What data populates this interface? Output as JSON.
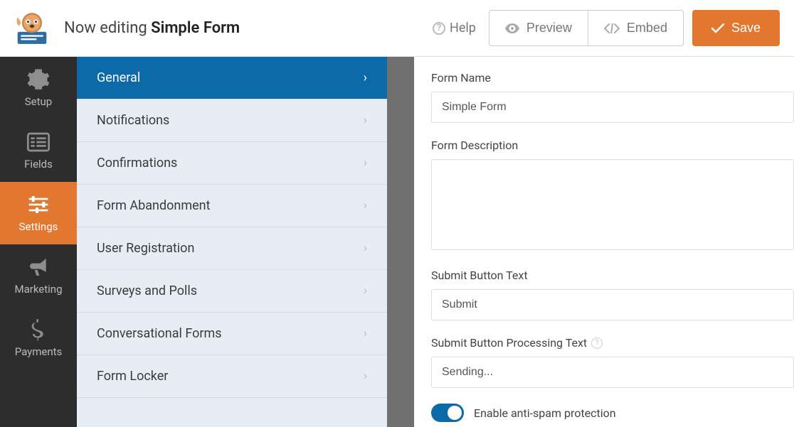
{
  "header": {
    "editing_prefix": "Now editing ",
    "form_name": "Simple Form",
    "help_label": "Help",
    "preview_label": "Preview",
    "embed_label": "Embed",
    "save_label": "Save"
  },
  "vnav": {
    "items": [
      {
        "id": "setup",
        "label": "Setup",
        "icon": "gear"
      },
      {
        "id": "fields",
        "label": "Fields",
        "icon": "list"
      },
      {
        "id": "settings",
        "label": "Settings",
        "icon": "sliders",
        "active": true
      },
      {
        "id": "marketing",
        "label": "Marketing",
        "icon": "bullhorn"
      },
      {
        "id": "payments",
        "label": "Payments",
        "icon": "dollar"
      }
    ]
  },
  "settings_list": {
    "items": [
      {
        "label": "General",
        "active": true
      },
      {
        "label": "Notifications"
      },
      {
        "label": "Confirmations"
      },
      {
        "label": "Form Abandonment"
      },
      {
        "label": "User Registration"
      },
      {
        "label": "Surveys and Polls"
      },
      {
        "label": "Conversational Forms"
      },
      {
        "label": "Form Locker"
      }
    ]
  },
  "form": {
    "name_label": "Form Name",
    "name_value": "Simple Form",
    "description_label": "Form Description",
    "description_value": "",
    "submit_label": "Submit Button Text",
    "submit_value": "Submit",
    "processing_label": "Submit Button Processing Text",
    "processing_value": "Sending...",
    "antispam_label": "Enable anti-spam protection",
    "antispam_enabled": true
  },
  "colors": {
    "accent_orange": "#e27730",
    "accent_blue": "#0d6aa8",
    "nav_bg": "#2d2d2d",
    "panel_bg": "#e6edf4"
  }
}
